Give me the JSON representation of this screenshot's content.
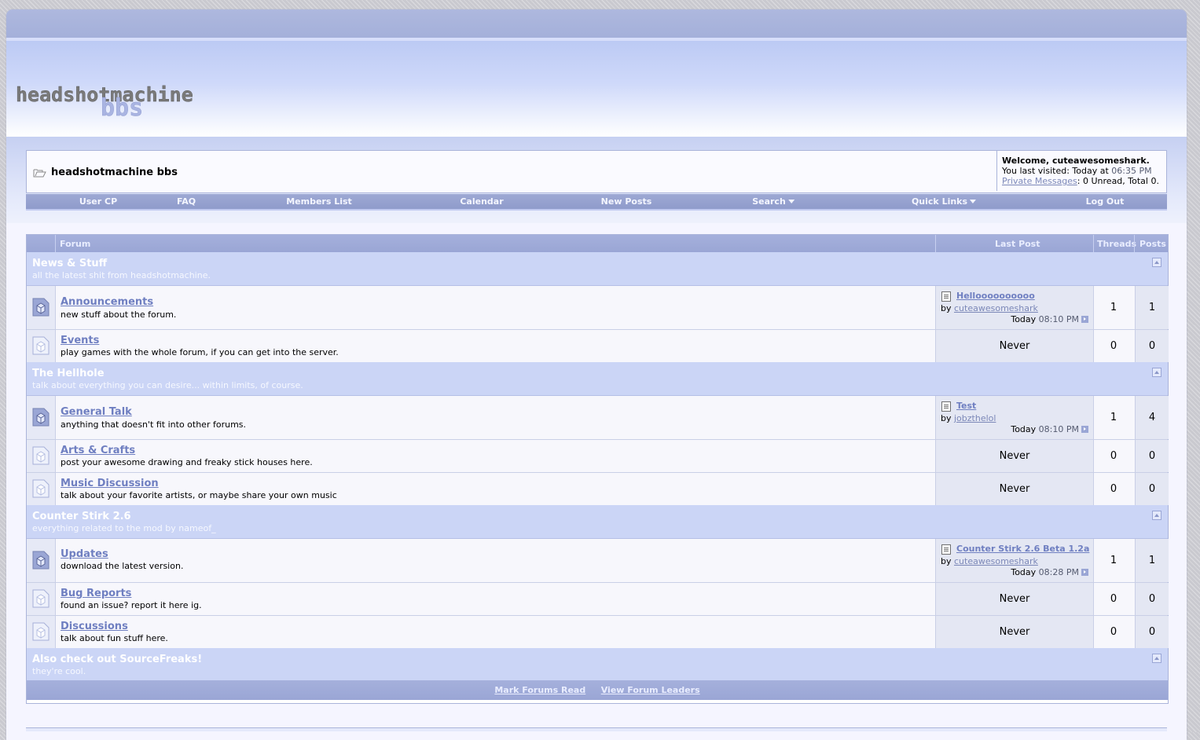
{
  "site": {
    "logo_top": "headshotmachine",
    "logo_bottom": "bbs"
  },
  "navbar": {
    "title": "headshotmachine bbs",
    "welcome": "Welcome, cuteawesomeshark.",
    "last_visited_label": "You last visited: Today at",
    "last_visited_time": "06:35 PM",
    "pm_link": "Private Messages",
    "pm_status": ": 0 Unread, Total 0."
  },
  "menu": {
    "items": [
      "User CP",
      "FAQ",
      "Members List",
      "Calendar",
      "New Posts",
      "Search",
      "Quick Links",
      "Log Out"
    ]
  },
  "table": {
    "col_forum": "Forum",
    "col_last_post": "Last Post",
    "col_threads": "Threads",
    "col_posts": "Posts"
  },
  "categories": [
    {
      "title": "News & Stuff",
      "desc": "all the latest shit from headshotmachine."
    },
    {
      "title": "The Hellhole",
      "desc": "talk about everything you can desire... within limits, of course."
    },
    {
      "title": "Counter Stirk 2.6",
      "desc": "everything related to the mod by nameof_"
    },
    {
      "title": "Also check out SourceFreaks!",
      "desc": "they're cool."
    }
  ],
  "forums": [
    {
      "name": "Announcements",
      "desc": "new stuff about the forum.",
      "lp_title": "Helloooooooooo",
      "lp_by_label": "by",
      "lp_user": "cuteawesomeshark",
      "lp_day": "Today",
      "lp_time": "08:10 PM",
      "threads": "1",
      "posts": "1"
    },
    {
      "name": "Events",
      "desc": "play games with the whole forum, if you can get into the server.",
      "never": "Never",
      "threads": "0",
      "posts": "0"
    },
    {
      "name": "General Talk",
      "desc": "anything that doesn't fit into other forums.",
      "lp_title": "Test",
      "lp_by_label": "by",
      "lp_user": "jobzthelol",
      "lp_day": "Today",
      "lp_time": "08:10 PM",
      "threads": "1",
      "posts": "4"
    },
    {
      "name": "Arts & Crafts",
      "desc": "post your awesome drawing and freaky stick houses here.",
      "never": "Never",
      "threads": "0",
      "posts": "0"
    },
    {
      "name": "Music Discussion",
      "desc": "talk about your favorite artists, or maybe share your own music",
      "never": "Never",
      "threads": "0",
      "posts": "0"
    },
    {
      "name": "Updates",
      "desc": "download the latest version.",
      "lp_title": "Counter Stirk 2.6 Beta 1.2a",
      "lp_by_label": "by",
      "lp_user": "cuteawesomeshark",
      "lp_day": "Today",
      "lp_time": "08:28 PM",
      "threads": "1",
      "posts": "1"
    },
    {
      "name": "Bug Reports",
      "desc": "found an issue? report it here ig.",
      "never": "Never",
      "threads": "0",
      "posts": "0"
    },
    {
      "name": "Discussions",
      "desc": "talk about fun stuff here.",
      "never": "Never",
      "threads": "0",
      "posts": "0"
    }
  ],
  "footer": {
    "mark_read": "Mark Forums Read",
    "leaders": "View Forum Leaders"
  },
  "colors": {
    "accent": "#6f7fc1",
    "header_bar": "#9aa6d5",
    "category_bg": "#cbd5f6"
  }
}
